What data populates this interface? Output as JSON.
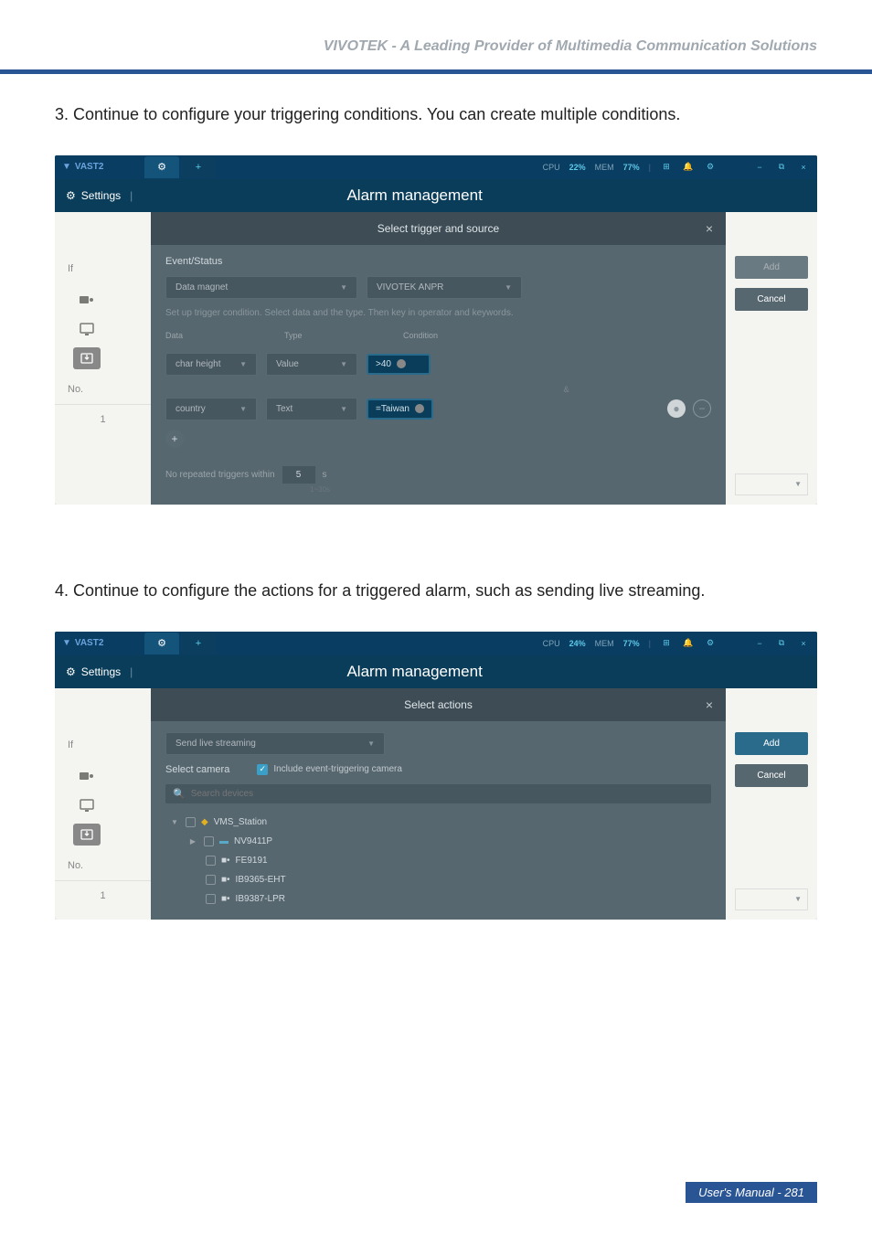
{
  "header": {
    "title": "VIVOTEK - A Leading Provider of Multimedia Communication Solutions"
  },
  "steps": {
    "s3": "3. Continue to configure your triggering conditions. You can create multiple conditions.",
    "s4": "4. Continue to configure the actions for a triggered alarm, such as sending live streaming."
  },
  "app": {
    "name": "VAST2",
    "stats1": {
      "cpu_label": "CPU",
      "cpu_val": "22%",
      "mem_label": "MEM",
      "mem_val": "77%"
    },
    "stats2": {
      "cpu_label": "CPU",
      "cpu_val": "24%",
      "mem_label": "MEM",
      "mem_val": "77%"
    },
    "settings": "Settings",
    "page_title": "Alarm management"
  },
  "panel1": {
    "strip": "Select trigger and source",
    "event_status": "Event/Status",
    "source": "Data magnet",
    "source2": "VIVOTEK ANPR",
    "hint": "Set up trigger condition. Select data and the type. Then key in operator and keywords.",
    "cols": {
      "data": "Data",
      "type": "Type",
      "cond": "Condition"
    },
    "row1": {
      "data": "char height",
      "type": "Value",
      "cond": ">40"
    },
    "amp": "&",
    "row2": {
      "data": "country",
      "type": "Text",
      "cond": "=Taiwan"
    },
    "repeat_label": "No repeated triggers within",
    "repeat_val": "5",
    "repeat_unit": "s",
    "repeat_hint": "1~30s"
  },
  "panel2": {
    "strip": "Select actions",
    "action": "Send live streaming",
    "select_camera": "Select camera",
    "include_trigger": "Include event-triggering camera",
    "search_placeholder": "Search devices",
    "tree": {
      "root": "VMS_Station",
      "nv": "NV9411P",
      "cams": [
        "FE9191",
        "IB9365-EHT",
        "IB9387-LPR"
      ]
    }
  },
  "sidebar": {
    "if": "If",
    "no": "No.",
    "row1": "1"
  },
  "buttons": {
    "add": "Add",
    "cancel": "Cancel"
  },
  "footer": "User's Manual - 281"
}
